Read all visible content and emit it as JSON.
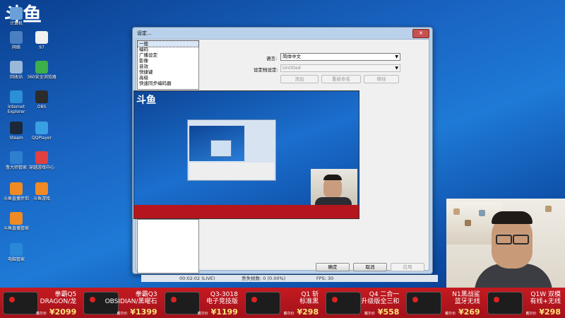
{
  "desktop": {
    "logo_text": "斗鱼",
    "icons": [
      {
        "label": "计算机",
        "color": "#6aa0d8"
      },
      {
        "label": "网络",
        "color": "#4a7fc1"
      },
      {
        "label": "97",
        "color": "#f0f0f0"
      },
      {
        "label": "回收站",
        "color": "#9ab8d8"
      },
      {
        "label": "360安全浏览器",
        "color": "#3cae4a"
      },
      {
        "label": "Internet Explorer",
        "color": "#2d8fd6"
      },
      {
        "label": "OBS",
        "color": "#2b2b2b"
      },
      {
        "label": "Steam",
        "color": "#1b2838"
      },
      {
        "label": "QQPlayer",
        "color": "#39a0e3"
      },
      {
        "label": "鲁大师管家",
        "color": "#2e7fd0"
      },
      {
        "label": "穿越游戏中心",
        "color": "#e04040"
      },
      {
        "label": "斗鱼直播伴侣",
        "color": "#f08a24"
      },
      {
        "label": "斗鱼游戏",
        "color": "#f08a24"
      },
      {
        "label": "斗鱼直播管家",
        "color": "#f08a24"
      },
      {
        "label": "电脑管家",
        "color": "#2a88d8"
      }
    ]
  },
  "dialog": {
    "title": "设定...",
    "close_glyph": "×",
    "categories": [
      "一般",
      "编码",
      "广播设定",
      "影像",
      "音效",
      "快捷键",
      "高级",
      "快速同步编码器"
    ],
    "selected_category": "一般",
    "language_label": "语言:",
    "language_value": "简体中文",
    "profile_label": "设定档设定:",
    "profile_value": "Untitled",
    "add_button": "添加",
    "rename_button": "重新命名",
    "remove_button": "移除",
    "ok_button": "确定",
    "cancel_button": "取消",
    "apply_button": "应用"
  },
  "status_bar": {
    "time": "00:02:02 (LIVE)",
    "dropped": "丢失帧数: 0 (0.00%)",
    "fps": "FPS: 30"
  },
  "products": [
    {
      "name1": "拳霸Q5",
      "name2": "DRAGON/龙",
      "price": "2099",
      "price_label": "戴尔价"
    },
    {
      "name1": "拳霸Q3",
      "name2": "OBSIDIAN/黑曜石",
      "price": "1399",
      "price_label": "戴尔价"
    },
    {
      "name1": "Q3-3018",
      "name2": "电子竞技版",
      "price": "1199",
      "price_label": "戴尔价"
    },
    {
      "name1": "Q1 斩",
      "name2": "标准黑",
      "price": "298",
      "price_label": "戴尔价"
    },
    {
      "name1": "Q4 二合一",
      "name2": "升级版全三和",
      "price": "558",
      "price_label": "戴尔价"
    },
    {
      "name1": "N1黑战鲨",
      "name2": "蓝牙无线",
      "price": "269",
      "price_label": "戴尔价"
    },
    {
      "name1": "Q1W 双模",
      "name2": "有线+无线",
      "price": "298",
      "price_label": "戴尔价"
    }
  ]
}
